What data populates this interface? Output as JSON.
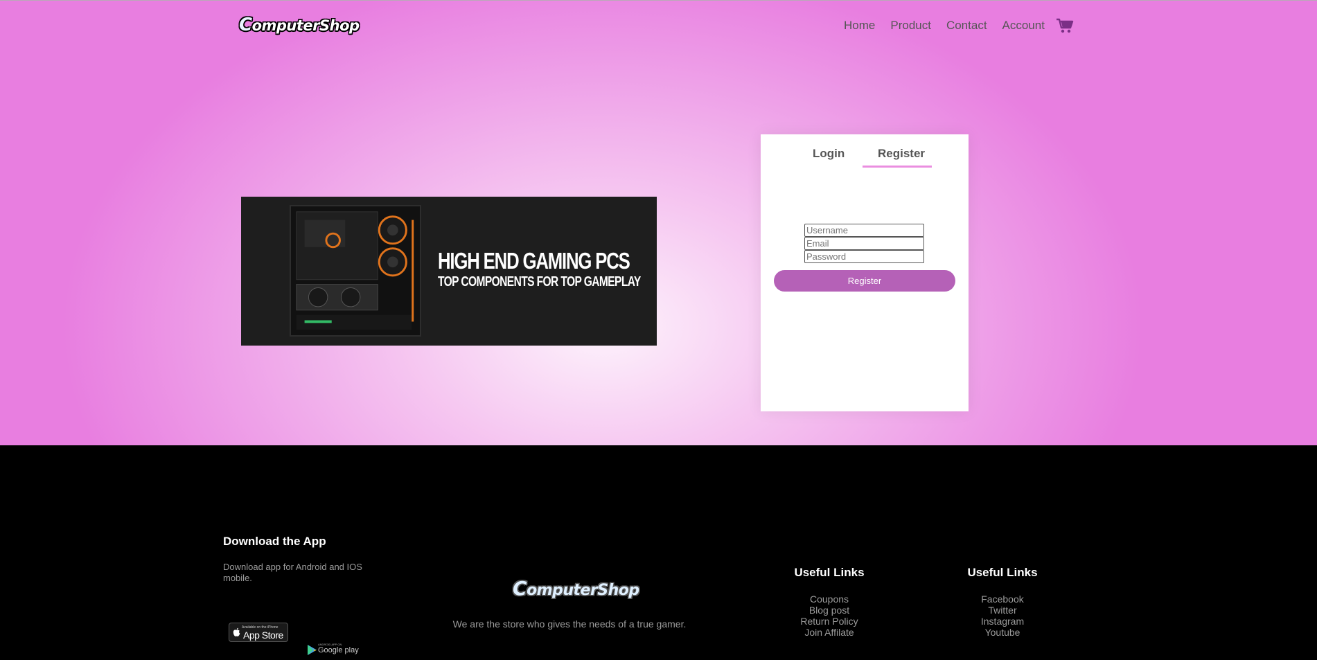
{
  "brand": {
    "logo_text": "omputerShop",
    "logo_letter": "C"
  },
  "nav": {
    "items": [
      "Home",
      "Product",
      "Contact",
      "Account"
    ],
    "cart_icon": "cart-icon"
  },
  "banner": {
    "title": "HIGH END GAMING PCS",
    "subtitle": "TOP COMPONENTS FOR TOP GAMEPLAY"
  },
  "form": {
    "tabs": {
      "login": "Login",
      "register": "Register",
      "active": "register"
    },
    "fields": {
      "username": {
        "placeholder": "Username",
        "value": ""
      },
      "email": {
        "placeholder": "Email",
        "value": ""
      },
      "password": {
        "placeholder": "Password",
        "value": ""
      }
    },
    "submit_label": "Register"
  },
  "footer": {
    "download": {
      "title": "Download the App",
      "text": "Download app for Android and IOS mobile.",
      "appstore": {
        "small": "Available on the iPhone",
        "big": "App Store"
      },
      "googleplay": {
        "small": "ANDROID APP ON",
        "big": "Google play"
      }
    },
    "logo_text": "omputerShop",
    "logo_letter": "C",
    "tagline": "We are the store who gives the needs of a true gamer.",
    "columns": [
      {
        "title": "Useful Links",
        "links": [
          "Coupons",
          "Blog post",
          "Return Policy",
          "Join Affilate"
        ]
      },
      {
        "title": "Useful Links",
        "links": [
          "Facebook",
          "Twitter",
          "Instagram",
          "Youtube"
        ]
      }
    ]
  },
  "colors": {
    "accent": "#b561b7",
    "tab_underline": "#ea8ee0",
    "hero_gradient_center": "#fdf3fc",
    "hero_gradient_edge": "#e87ee0",
    "footer_bg": "#000000"
  }
}
